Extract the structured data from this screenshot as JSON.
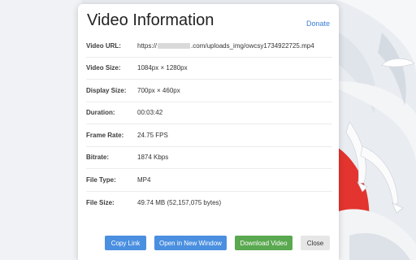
{
  "modal": {
    "title": "Video Information",
    "donate_label": "Donate"
  },
  "url": {
    "label": "Video URL:",
    "prefix": "https://",
    "suffix": ".com/uploads_img/owcsy1734922725.mp4"
  },
  "rows": [
    {
      "label": "Video Size:",
      "value": "1084px × 1280px"
    },
    {
      "label": "Display Size:",
      "value": "700px × 460px"
    },
    {
      "label": "Duration:",
      "value": "00:03:42"
    },
    {
      "label": "Frame Rate:",
      "value": "24.75 FPS"
    },
    {
      "label": "Bitrate:",
      "value": "1874 Kbps"
    },
    {
      "label": "File Type:",
      "value": "MP4"
    },
    {
      "label": "File Size:",
      "value": "49.74 MB (52,157,075 bytes)"
    }
  ],
  "buttons": {
    "copy_link": "Copy Link",
    "open_new_window": "Open in New Window",
    "download_video": "Download Video",
    "close": "Close"
  },
  "colors": {
    "primary_button": "#4a8fe0",
    "download_button": "#5aa84f",
    "close_button": "#e6e6e6",
    "link": "#3a7fd8"
  }
}
